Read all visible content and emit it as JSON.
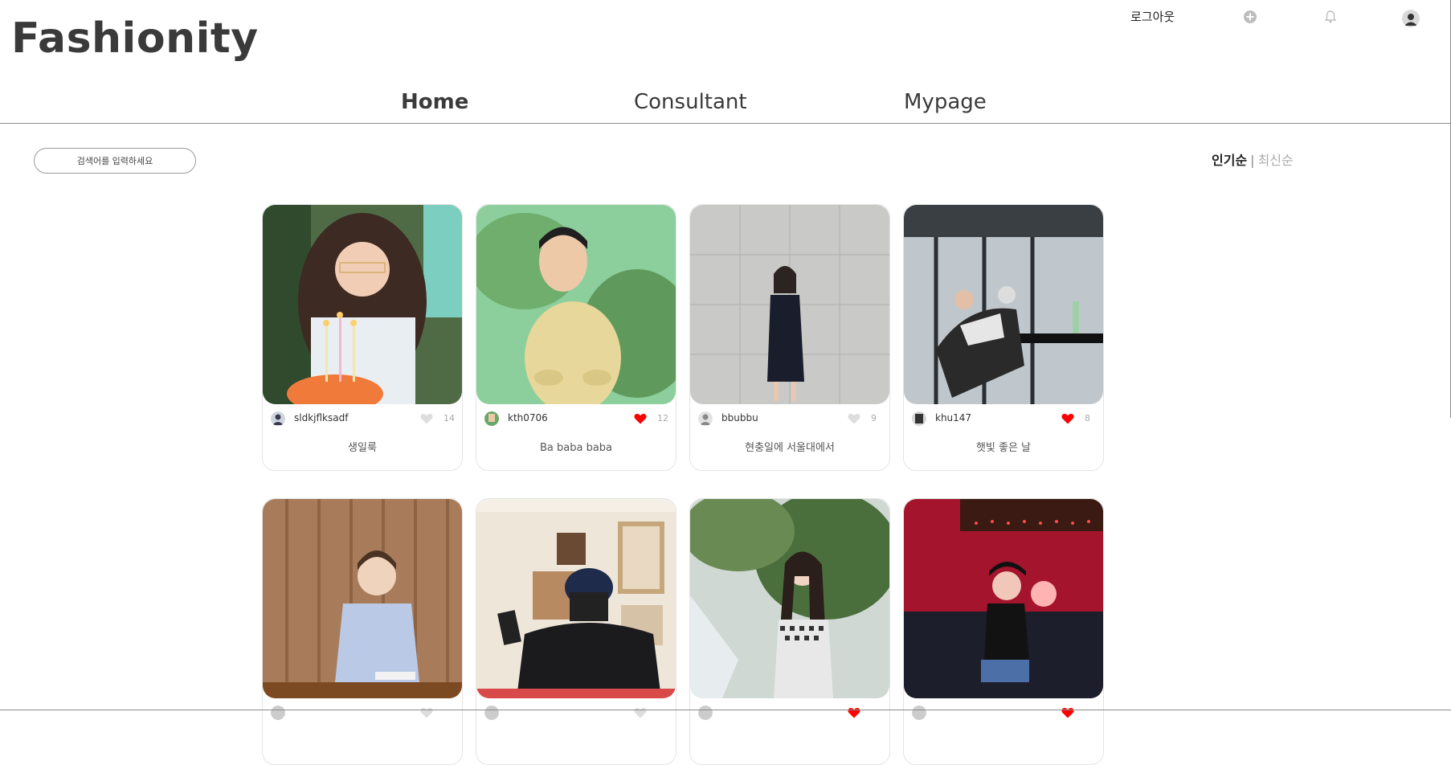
{
  "app": {
    "logo": "Fashionity"
  },
  "topbar": {
    "logout_label": "로그아웃",
    "icons": [
      "plus-circle-icon",
      "bell-icon",
      "user-avatar"
    ]
  },
  "nav": {
    "items": [
      {
        "label": "Home",
        "active": true
      },
      {
        "label": "Consultant"
      },
      {
        "label": "Mypage"
      }
    ]
  },
  "search": {
    "placeholder": "검색어를 입력하세요"
  },
  "sort": {
    "popular": "인기순",
    "separator": "|",
    "latest": "최신순",
    "selected": "인기순"
  },
  "colors": {
    "liked_heart": "#ff0000",
    "unliked_heart": "#dddddd",
    "text_dark": "#3a3a3a"
  },
  "posts": [
    {
      "username": "sldkjflksadf",
      "likes": "14",
      "liked": false,
      "caption": "생일룩"
    },
    {
      "username": "kth0706",
      "likes": "12",
      "liked": true,
      "caption": "Ba baba baba"
    },
    {
      "username": "bbubbu",
      "likes": "9",
      "liked": false,
      "caption": "현충일에 서울대에서"
    },
    {
      "username": "khu147",
      "likes": "8",
      "liked": true,
      "caption": "햇빛 좋은 날"
    },
    {
      "username": "",
      "likes": "",
      "liked": false,
      "caption": ""
    },
    {
      "username": "",
      "likes": "",
      "liked": false,
      "caption": ""
    },
    {
      "username": "",
      "likes": "",
      "liked": true,
      "caption": ""
    },
    {
      "username": "",
      "likes": "",
      "liked": true,
      "caption": ""
    }
  ]
}
